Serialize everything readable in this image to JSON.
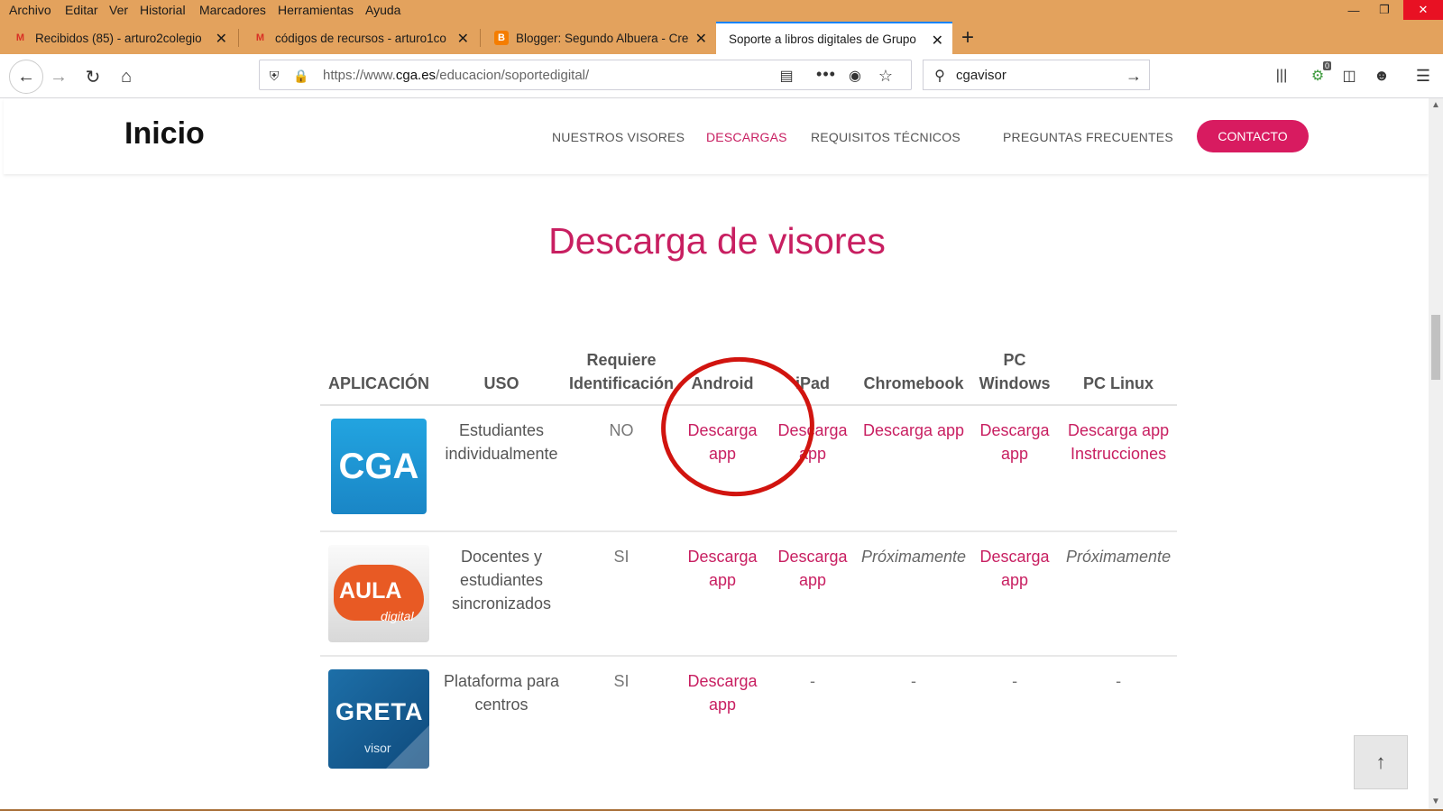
{
  "menubar": {
    "items": [
      "Archivo",
      "Editar",
      "Ver",
      "Historial",
      "Marcadores",
      "Herramientas",
      "Ayuda"
    ]
  },
  "tabs": [
    {
      "title": "Recibidos (85) - arturo2colegio",
      "icon": "gmail-icon"
    },
    {
      "title": "códigos de recursos - arturo1co",
      "icon": "gmail-icon"
    },
    {
      "title": "Blogger: Segundo Albuera - Cre",
      "icon": "blogger-icon"
    },
    {
      "title": "Soporte a libros digitales de Grupo",
      "icon": "none"
    }
  ],
  "urlbar": {
    "prefix": "https://www.",
    "domain": "cga.es",
    "path": "/educacion/soportedigital/"
  },
  "search": {
    "value": "cgavisor"
  },
  "toolbar": {
    "notification_badge": "0"
  },
  "site": {
    "logo": "Inicio",
    "nav": [
      "NUESTROS VISORES",
      "DESCARGAS",
      "REQUISITOS TÉCNICOS",
      "PREGUNTAS FRECUENTES"
    ],
    "contact": "CONTACTO",
    "accent": "#d81b60"
  },
  "main": {
    "title": "Descarga de visores",
    "headers": [
      "APLICACIÓN",
      "USO",
      "Requiere Identificación",
      "Android",
      "iPad",
      "Chromebook",
      "PC Windows",
      "PC Linux"
    ],
    "rows": [
      {
        "app": "CGA",
        "uso": "Estudiantes individualmente",
        "requiere": "NO",
        "android": "Descarga app",
        "ipad": "Descarga app",
        "chromebook": "Descarga app",
        "windows": "Descarga app",
        "linux": "Descarga app",
        "linux2": "Instrucciones"
      },
      {
        "app_line1": "AULA",
        "app_line2": "digital",
        "uso": "Docentes y estudiantes sincronizados",
        "requiere": "SI",
        "android": "Descarga app",
        "ipad": "Descarga app",
        "chromebook": "Próximamente",
        "windows": "Descarga app",
        "linux": "Próximamente"
      },
      {
        "app_line1": "GRETA",
        "app_line2": "visor",
        "uso": "Plataforma para centros",
        "requiere": "SI",
        "android": "Descarga app",
        "ipad": "-",
        "chromebook": "-",
        "windows": "-",
        "linux": "-"
      }
    ]
  }
}
